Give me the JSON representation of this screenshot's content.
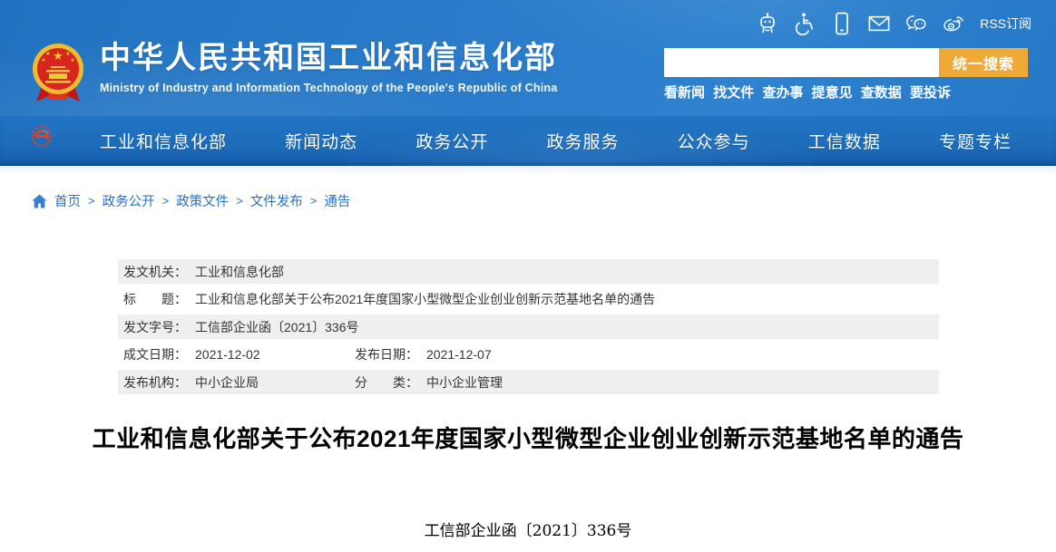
{
  "colors": {
    "header_blue": "#2578c6",
    "nav_blue": "#1d6cba",
    "accent_orange": "#efa937",
    "link_blue": "#2a6fc0",
    "row_gray": "#efefef",
    "emblem_gold": "#eebb31",
    "emblem_red": "#d7261d",
    "logo_red": "#e8401c"
  },
  "header": {
    "site_title": "中华人民共和国工业和信息化部",
    "site_subtitle": "Ministry of Industry and Information Technology of the People's Republic of China",
    "utility_icons": [
      {
        "name": "ai-assistant-robot-icon"
      },
      {
        "name": "accessibility-wheelchair-icon"
      },
      {
        "name": "mobile-phone-icon"
      },
      {
        "name": "mail-envelope-icon"
      },
      {
        "name": "wechat-icon"
      },
      {
        "name": "weibo-icon"
      }
    ],
    "rss_label": "RSS订阅",
    "search": {
      "value": "",
      "button_label": "统一搜索"
    },
    "quick_links": [
      "看新闻",
      "找文件",
      "查办事",
      "提意见",
      "查数据",
      "要投诉"
    ]
  },
  "nav": {
    "items": [
      "工业和信息化部",
      "新闻动态",
      "政务公开",
      "政务服务",
      "公众参与",
      "工信数据",
      "专题专栏"
    ]
  },
  "breadcrumb": {
    "separator": ">",
    "items": [
      "首页",
      "政务公开",
      "政策文件",
      "文件发布",
      "通告"
    ]
  },
  "doc_meta": {
    "rows": [
      {
        "cells": [
          {
            "label": "发文机关：",
            "value": "工业和信息化部"
          }
        ]
      },
      {
        "cells": [
          {
            "label": "标　　题：",
            "value": "工业和信息化部关于公布2021年度国家小型微型企业创业创新示范基地名单的通告"
          }
        ]
      },
      {
        "cells": [
          {
            "label": "发文字号：",
            "value": "工信部企业函〔2021〕336号"
          }
        ]
      },
      {
        "cells": [
          {
            "label": "成文日期：",
            "value": "2021-12-02"
          },
          {
            "label": "发布日期：",
            "value": "2021-12-07"
          }
        ]
      },
      {
        "cells": [
          {
            "label": "发布机构：",
            "value": "中小企业局"
          },
          {
            "label": "分　　类：",
            "value": "中小企业管理"
          }
        ]
      }
    ]
  },
  "article": {
    "title": "工业和信息化部关于公布2021年度国家小型微型企业创业创新示范基地名单的通告",
    "doc_number": "工信部企业函〔2021〕336号"
  }
}
